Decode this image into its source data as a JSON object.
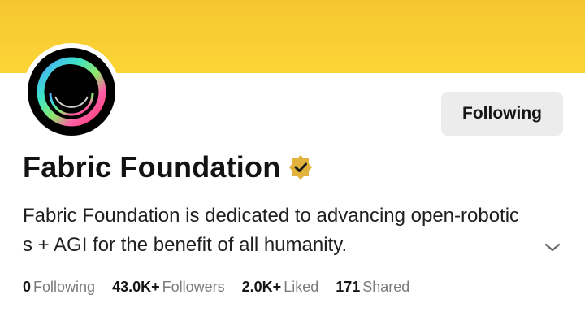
{
  "profile": {
    "name": "Fabric Foundation",
    "bio": "Fabric Foundation is dedicated to advancing open-robotics + AGI for the benefit of all humanity.",
    "verified_icon": "verified-badge-icon",
    "avatar_icon": "fabric-ring-logo"
  },
  "actions": {
    "follow_label": "Following"
  },
  "stats": [
    {
      "value": "0",
      "label": "Following"
    },
    {
      "value": "43.0K+",
      "label": "Followers"
    },
    {
      "value": "2.0K+",
      "label": "Liked"
    },
    {
      "value": "171",
      "label": "Shared"
    }
  ],
  "colors": {
    "banner": "#fcd535",
    "badge": "#e3b23c",
    "button_bg": "#ececec"
  },
  "icons": {
    "expand": "chevron-down-icon"
  }
}
